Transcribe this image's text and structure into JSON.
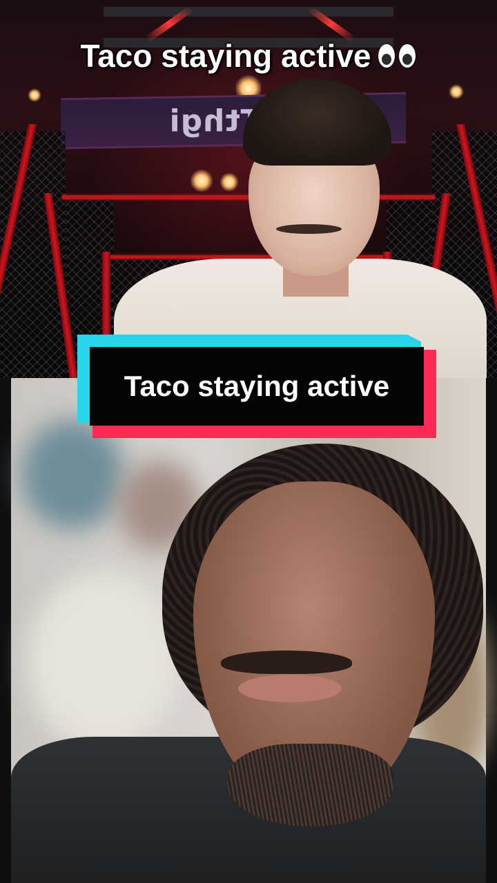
{
  "video": {
    "caption": "Taco staying active",
    "caption_emoji_icon": "eyes-emoji-icon",
    "label_card_text": "Taco staying active",
    "background_sign_text": "klaTthgi"
  },
  "colors": {
    "label_cyan": "#27d4ea",
    "label_red": "#ff2a55",
    "label_black": "#050505",
    "cage_red": "#c0141c"
  }
}
